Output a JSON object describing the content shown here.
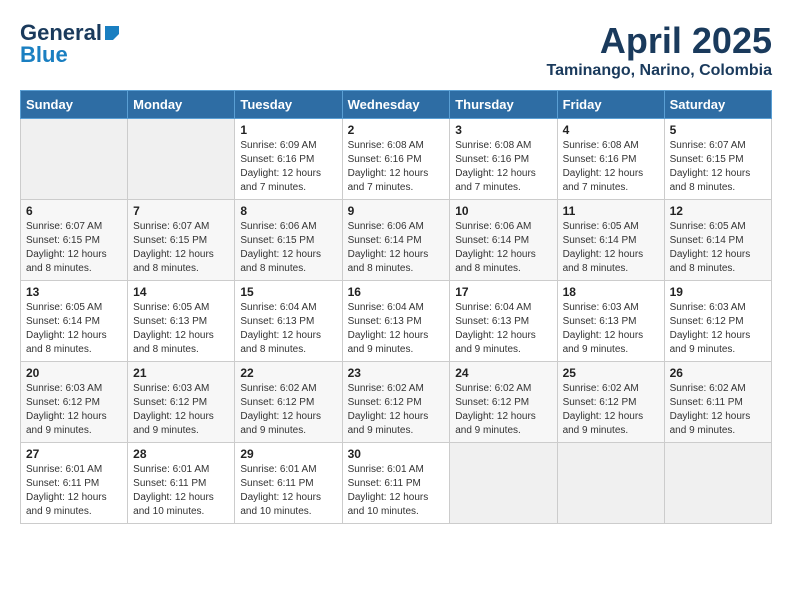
{
  "header": {
    "logo_general": "General",
    "logo_blue": "Blue",
    "month_year": "April 2025",
    "location": "Taminango, Narino, Colombia"
  },
  "calendar": {
    "days_of_week": [
      "Sunday",
      "Monday",
      "Tuesday",
      "Wednesday",
      "Thursday",
      "Friday",
      "Saturday"
    ],
    "weeks": [
      [
        {
          "day": "",
          "info": ""
        },
        {
          "day": "",
          "info": ""
        },
        {
          "day": "1",
          "info": "Sunrise: 6:09 AM\nSunset: 6:16 PM\nDaylight: 12 hours\nand 7 minutes."
        },
        {
          "day": "2",
          "info": "Sunrise: 6:08 AM\nSunset: 6:16 PM\nDaylight: 12 hours\nand 7 minutes."
        },
        {
          "day": "3",
          "info": "Sunrise: 6:08 AM\nSunset: 6:16 PM\nDaylight: 12 hours\nand 7 minutes."
        },
        {
          "day": "4",
          "info": "Sunrise: 6:08 AM\nSunset: 6:16 PM\nDaylight: 12 hours\nand 7 minutes."
        },
        {
          "day": "5",
          "info": "Sunrise: 6:07 AM\nSunset: 6:15 PM\nDaylight: 12 hours\nand 8 minutes."
        }
      ],
      [
        {
          "day": "6",
          "info": "Sunrise: 6:07 AM\nSunset: 6:15 PM\nDaylight: 12 hours\nand 8 minutes."
        },
        {
          "day": "7",
          "info": "Sunrise: 6:07 AM\nSunset: 6:15 PM\nDaylight: 12 hours\nand 8 minutes."
        },
        {
          "day": "8",
          "info": "Sunrise: 6:06 AM\nSunset: 6:15 PM\nDaylight: 12 hours\nand 8 minutes."
        },
        {
          "day": "9",
          "info": "Sunrise: 6:06 AM\nSunset: 6:14 PM\nDaylight: 12 hours\nand 8 minutes."
        },
        {
          "day": "10",
          "info": "Sunrise: 6:06 AM\nSunset: 6:14 PM\nDaylight: 12 hours\nand 8 minutes."
        },
        {
          "day": "11",
          "info": "Sunrise: 6:05 AM\nSunset: 6:14 PM\nDaylight: 12 hours\nand 8 minutes."
        },
        {
          "day": "12",
          "info": "Sunrise: 6:05 AM\nSunset: 6:14 PM\nDaylight: 12 hours\nand 8 minutes."
        }
      ],
      [
        {
          "day": "13",
          "info": "Sunrise: 6:05 AM\nSunset: 6:14 PM\nDaylight: 12 hours\nand 8 minutes."
        },
        {
          "day": "14",
          "info": "Sunrise: 6:05 AM\nSunset: 6:13 PM\nDaylight: 12 hours\nand 8 minutes."
        },
        {
          "day": "15",
          "info": "Sunrise: 6:04 AM\nSunset: 6:13 PM\nDaylight: 12 hours\nand 8 minutes."
        },
        {
          "day": "16",
          "info": "Sunrise: 6:04 AM\nSunset: 6:13 PM\nDaylight: 12 hours\nand 9 minutes."
        },
        {
          "day": "17",
          "info": "Sunrise: 6:04 AM\nSunset: 6:13 PM\nDaylight: 12 hours\nand 9 minutes."
        },
        {
          "day": "18",
          "info": "Sunrise: 6:03 AM\nSunset: 6:13 PM\nDaylight: 12 hours\nand 9 minutes."
        },
        {
          "day": "19",
          "info": "Sunrise: 6:03 AM\nSunset: 6:12 PM\nDaylight: 12 hours\nand 9 minutes."
        }
      ],
      [
        {
          "day": "20",
          "info": "Sunrise: 6:03 AM\nSunset: 6:12 PM\nDaylight: 12 hours\nand 9 minutes."
        },
        {
          "day": "21",
          "info": "Sunrise: 6:03 AM\nSunset: 6:12 PM\nDaylight: 12 hours\nand 9 minutes."
        },
        {
          "day": "22",
          "info": "Sunrise: 6:02 AM\nSunset: 6:12 PM\nDaylight: 12 hours\nand 9 minutes."
        },
        {
          "day": "23",
          "info": "Sunrise: 6:02 AM\nSunset: 6:12 PM\nDaylight: 12 hours\nand 9 minutes."
        },
        {
          "day": "24",
          "info": "Sunrise: 6:02 AM\nSunset: 6:12 PM\nDaylight: 12 hours\nand 9 minutes."
        },
        {
          "day": "25",
          "info": "Sunrise: 6:02 AM\nSunset: 6:12 PM\nDaylight: 12 hours\nand 9 minutes."
        },
        {
          "day": "26",
          "info": "Sunrise: 6:02 AM\nSunset: 6:11 PM\nDaylight: 12 hours\nand 9 minutes."
        }
      ],
      [
        {
          "day": "27",
          "info": "Sunrise: 6:01 AM\nSunset: 6:11 PM\nDaylight: 12 hours\nand 9 minutes."
        },
        {
          "day": "28",
          "info": "Sunrise: 6:01 AM\nSunset: 6:11 PM\nDaylight: 12 hours\nand 10 minutes."
        },
        {
          "day": "29",
          "info": "Sunrise: 6:01 AM\nSunset: 6:11 PM\nDaylight: 12 hours\nand 10 minutes."
        },
        {
          "day": "30",
          "info": "Sunrise: 6:01 AM\nSunset: 6:11 PM\nDaylight: 12 hours\nand 10 minutes."
        },
        {
          "day": "",
          "info": ""
        },
        {
          "day": "",
          "info": ""
        },
        {
          "day": "",
          "info": ""
        }
      ]
    ]
  }
}
